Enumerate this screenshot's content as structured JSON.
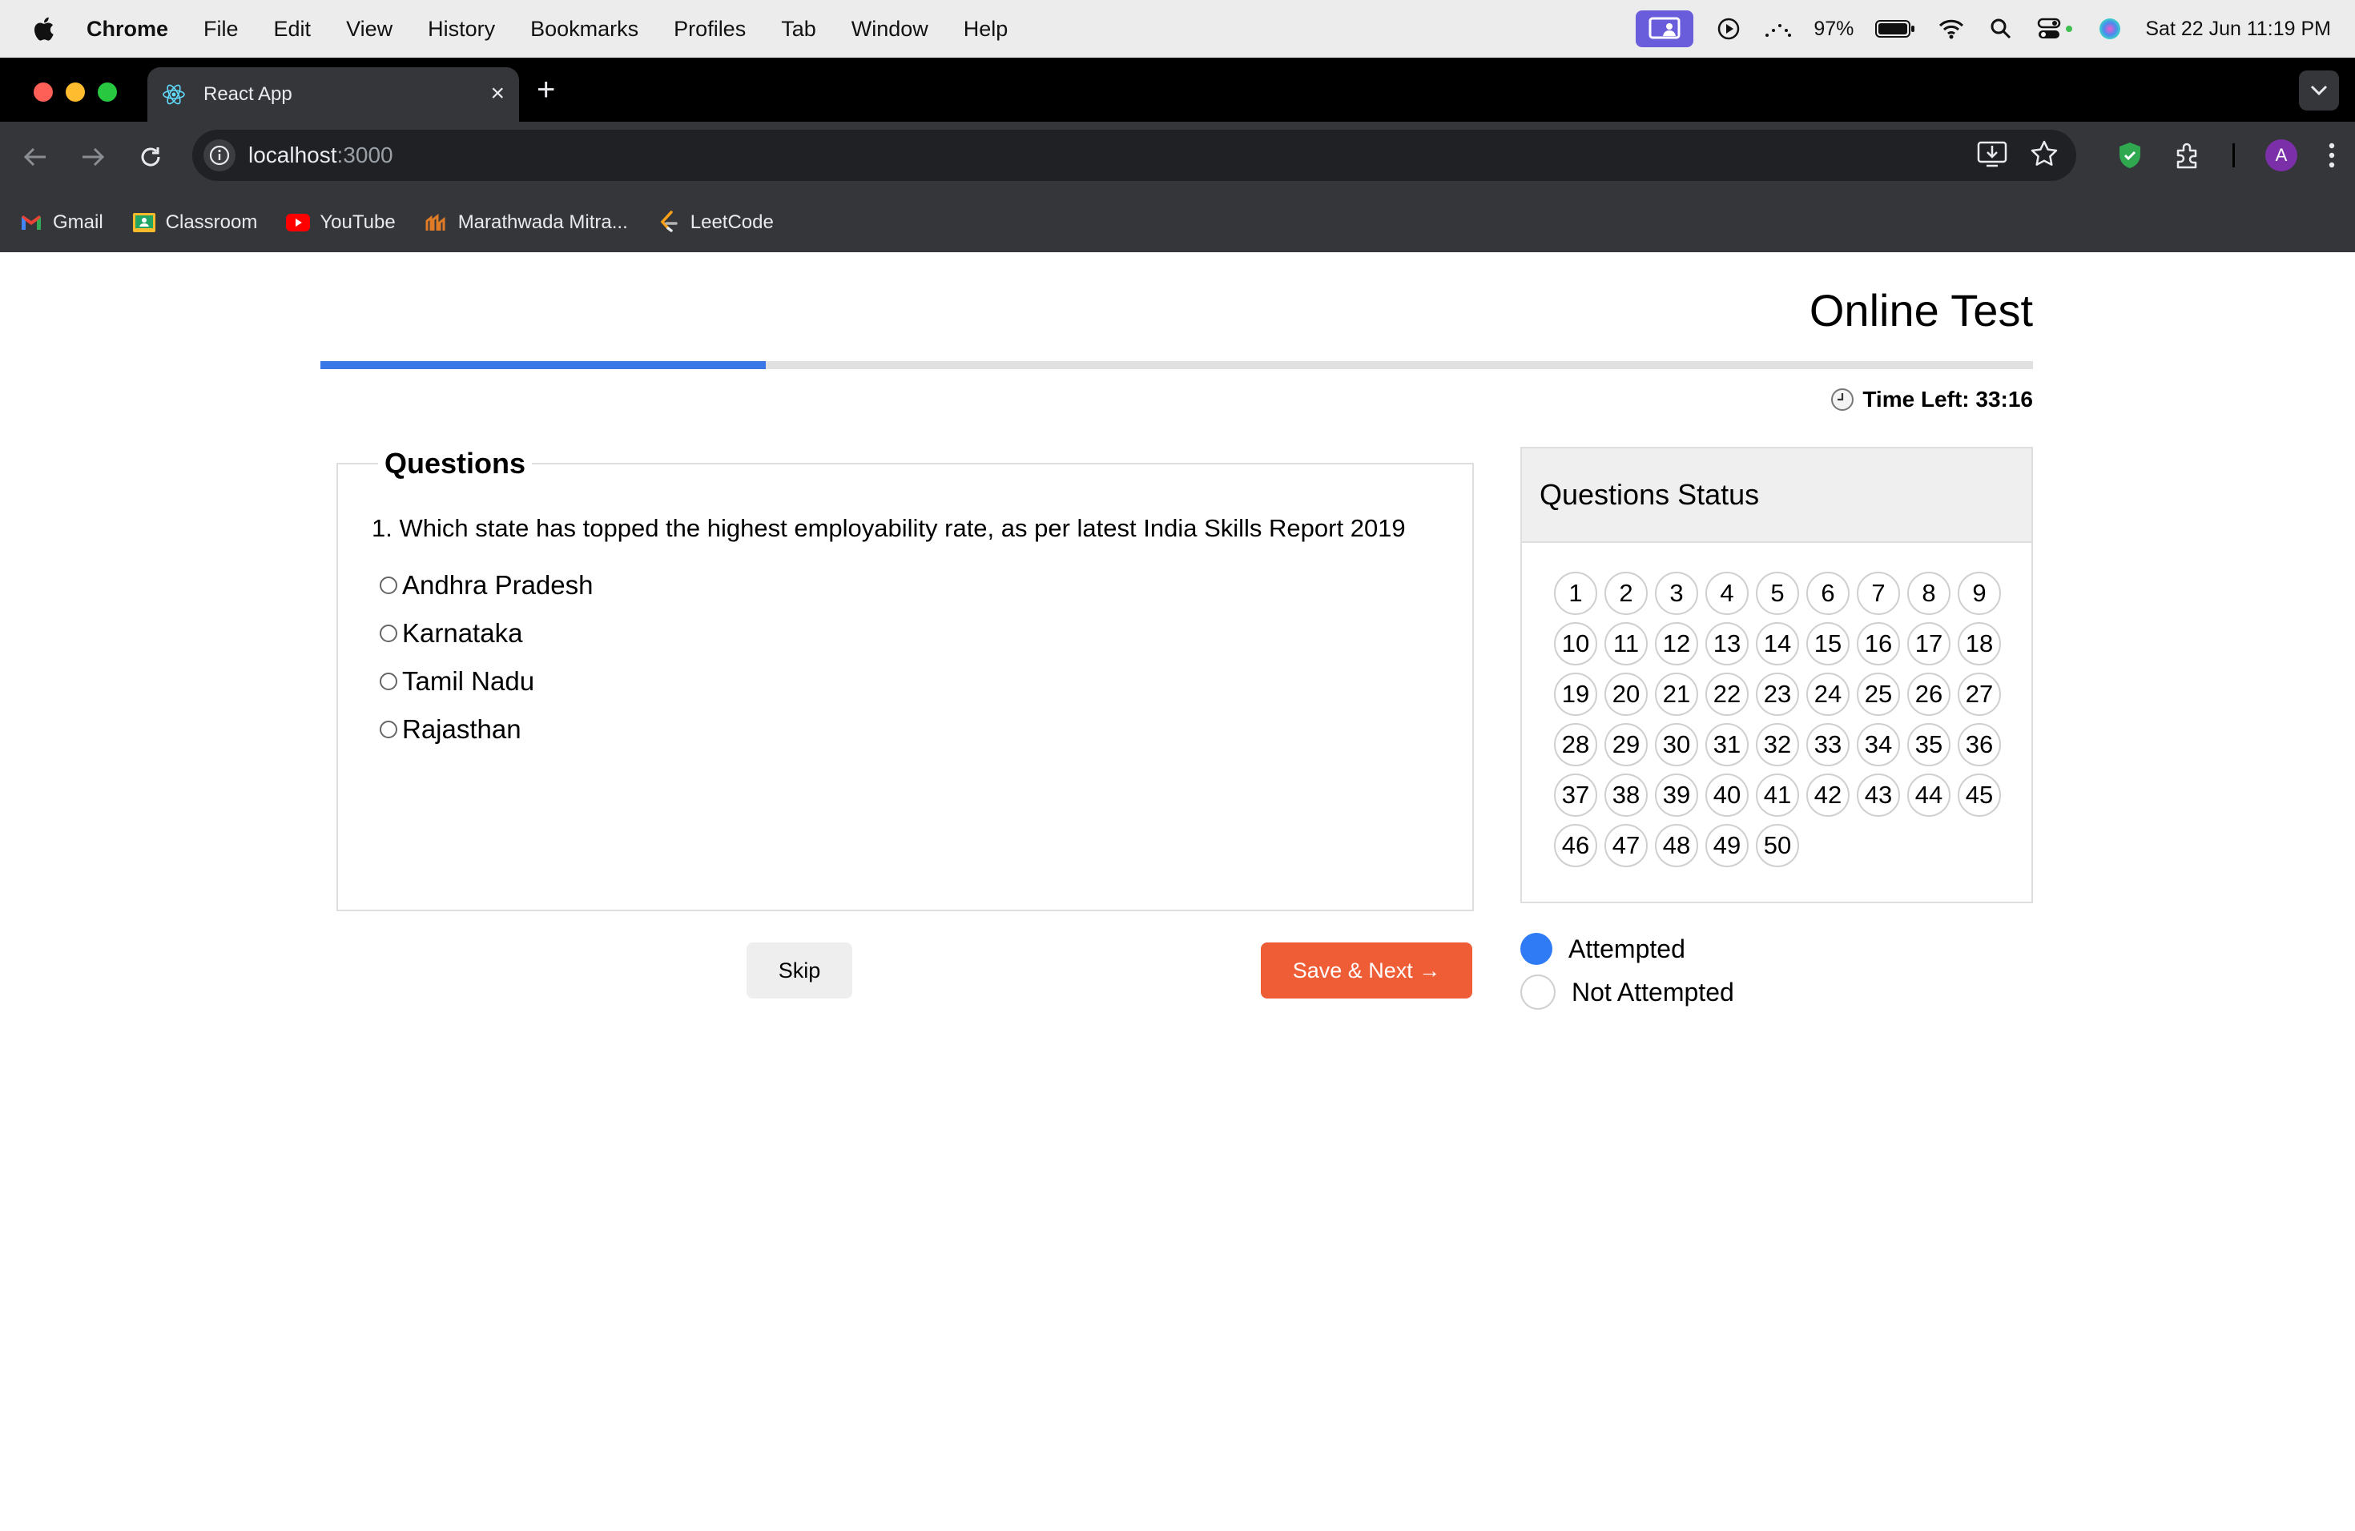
{
  "menubar": {
    "app_name": "Chrome",
    "menus": [
      "File",
      "Edit",
      "View",
      "History",
      "Bookmarks",
      "Profiles",
      "Tab",
      "Window",
      "Help"
    ],
    "battery": "97%",
    "datetime": "Sat 22 Jun  11:19 PM"
  },
  "browser": {
    "tab_title": "React App",
    "url_host": "localhost",
    "url_port": ":3000",
    "avatar_letter": "A",
    "bookmarks": [
      "Gmail",
      "Classroom",
      "YouTube",
      "Marathwada Mitra...",
      "LeetCode"
    ]
  },
  "page": {
    "title": "Online Test",
    "progress_fraction": 0.26,
    "timer_label": "Time Left: 33:16",
    "questions_heading": "Questions",
    "question_text": "1. Which state has topped the highest employability rate, as per latest India Skills Report 2019",
    "options": [
      "Andhra Pradesh",
      "Karnataka",
      "Tamil Nadu",
      "Rajasthan"
    ],
    "skip_label": "Skip",
    "next_label": "Save & Next →",
    "status_heading": "Questions Status",
    "question_numbers": [
      "1",
      "2",
      "3",
      "4",
      "5",
      "6",
      "7",
      "8",
      "9",
      "10",
      "11",
      "12",
      "13",
      "14",
      "15",
      "16",
      "17",
      "18",
      "19",
      "20",
      "21",
      "22",
      "23",
      "24",
      "25",
      "26",
      "27",
      "28",
      "29",
      "30",
      "31",
      "32",
      "33",
      "34",
      "35",
      "36",
      "37",
      "38",
      "39",
      "40",
      "41",
      "42",
      "43",
      "44",
      "45",
      "46",
      "47",
      "48",
      "49",
      "50"
    ],
    "legend_attempted": "Attempted",
    "legend_not_attempted": "Not Attempted",
    "colors": {
      "accent_blue": "#3b78e7",
      "next_button": "#ef5d36",
      "attempted_dot": "#2f7bf5"
    }
  }
}
